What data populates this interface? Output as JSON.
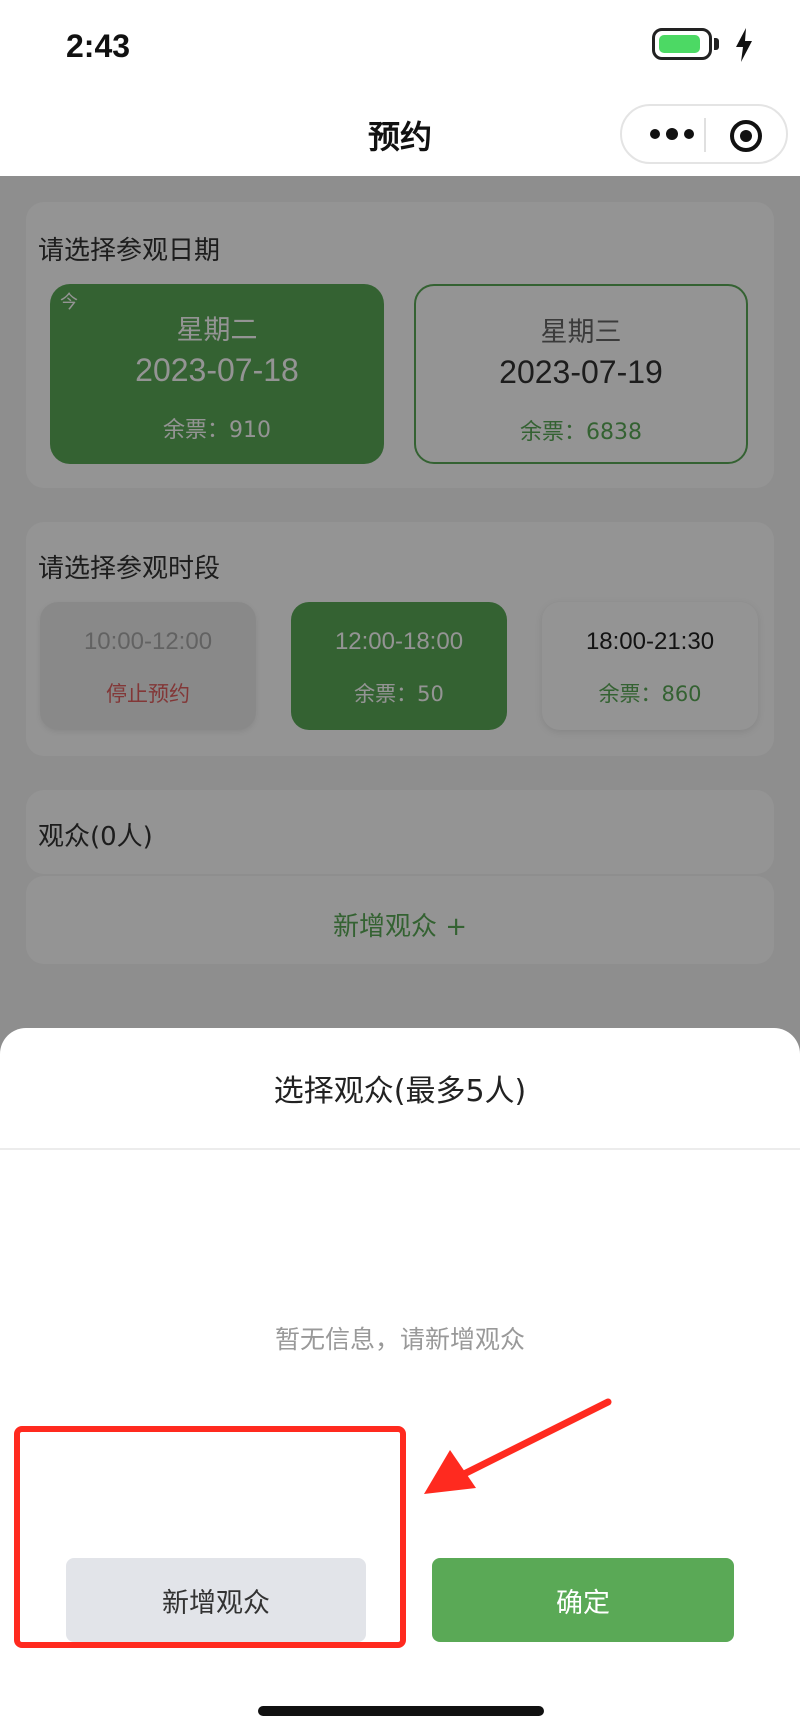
{
  "status_bar": {
    "time": "2:43",
    "battery_level": 0.85,
    "battery_color": "#4cd964"
  },
  "nav": {
    "title": "预约",
    "more_icon": "more-dots-icon",
    "close_icon": "target-icon"
  },
  "date_section": {
    "title": "请选择参观日期",
    "dates": [
      {
        "tag": "今",
        "weekday": "星期二",
        "date": "2023-07-18",
        "tickets": "余票：910",
        "selected": true
      },
      {
        "weekday": "星期三",
        "date": "2023-07-19",
        "tickets": "余票：6838",
        "selected": false
      }
    ]
  },
  "time_section": {
    "title": "请选择参观时段",
    "slots": [
      {
        "range": "10:00-12:00",
        "state": "停止预约",
        "status": "disabled"
      },
      {
        "range": "12:00-18:00",
        "state": "余票：50",
        "status": "selected"
      },
      {
        "range": "18:00-21:30",
        "state": "余票：860",
        "status": "normal"
      }
    ]
  },
  "audience_section": {
    "title": "观众(0人)",
    "add_label": "新增观众 +"
  },
  "sheet": {
    "title": "选择观众(最多5人)",
    "empty_text": "暂无信息，请新增观众",
    "add_button": "新增观众",
    "confirm_button": "确定"
  },
  "colors": {
    "accent_green": "#5aa956",
    "annotation_red": "#ff2a1f",
    "disabled_red": "#e06060"
  }
}
